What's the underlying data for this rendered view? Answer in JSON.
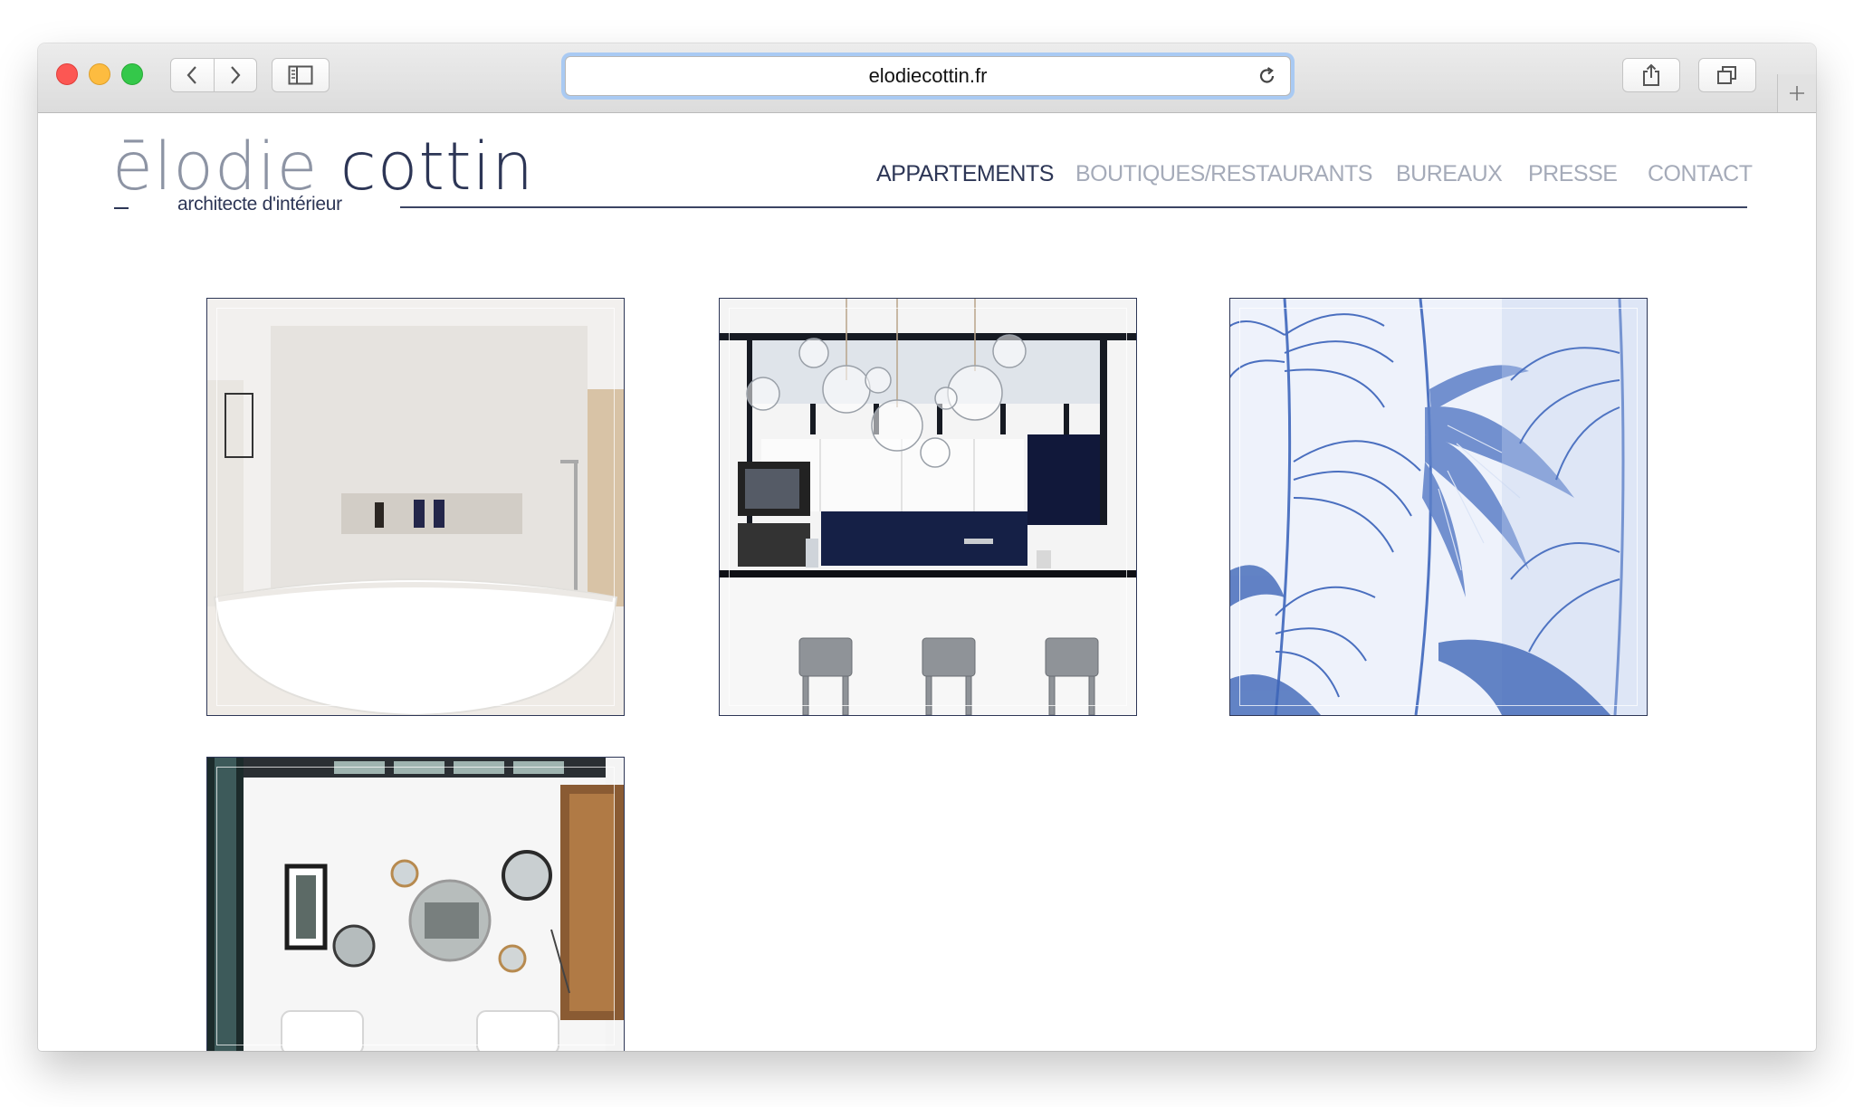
{
  "browser": {
    "url": "elodiecottin.fr",
    "back_icon": "chevron-left-icon",
    "forward_icon": "chevron-right-icon",
    "sidebar_icon": "sidebar-icon",
    "share_icon": "share-icon",
    "tabs_icon": "tabs-icon",
    "reload_icon": "reload-icon",
    "new_tab_icon": "plus-icon"
  },
  "site": {
    "logo": {
      "name_light": "ēlodie",
      "name_dark": "cottin",
      "subtitle": "architecte d'intérieur"
    },
    "nav": [
      {
        "label": "APPARTEMENTS",
        "active": true
      },
      {
        "label": "BOUTIQUES/RESTAURANTS",
        "active": false
      },
      {
        "label": "BUREAUX",
        "active": false
      },
      {
        "label": "PRESSE",
        "active": false
      },
      {
        "label": "CONTACT",
        "active": false
      }
    ],
    "gallery": [
      {
        "subject": "bathroom with freestanding bathtub"
      },
      {
        "subject": "kitchen with bubble glass pendant lights and bar stools"
      },
      {
        "subject": "blue palm leaf wallpaper"
      },
      {
        "subject": "white room with round mirrors and glass roof"
      }
    ]
  },
  "colors": {
    "brand_navy": "#2d3656",
    "nav_inactive": "#a5abb9",
    "address_focus": "#a9caf3"
  }
}
